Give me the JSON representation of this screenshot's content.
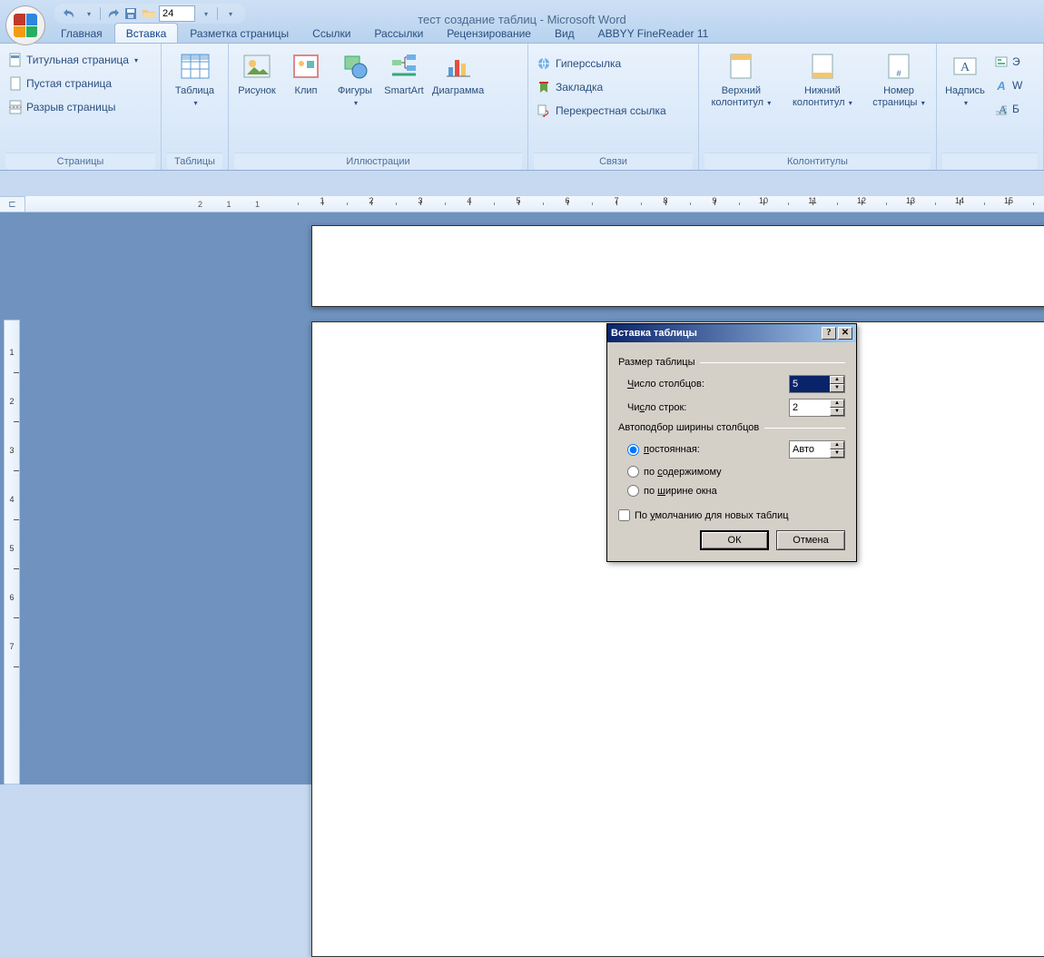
{
  "app_title": "тест создание таблиц - Microsoft Word",
  "qat": {
    "font_size": "24"
  },
  "tabs": {
    "home": "Главная",
    "insert": "Вставка",
    "layout": "Разметка страницы",
    "refs": "Ссылки",
    "mailings": "Рассылки",
    "review": "Рецензирование",
    "view": "Вид",
    "abbyy": "ABBYY FineReader 11"
  },
  "ribbon": {
    "pages": {
      "title_page": "Титульная страница",
      "blank_page": "Пустая страница",
      "page_break": "Разрыв страницы",
      "group": "Страницы"
    },
    "tables": {
      "table": "Таблица",
      "group": "Таблицы"
    },
    "illustrations": {
      "picture": "Рисунок",
      "clip": "Клип",
      "shapes": "Фигуры",
      "smartart": "SmartArt",
      "chart": "Диаграмма",
      "group": "Иллюстрации"
    },
    "links": {
      "hyperlink": "Гиперссылка",
      "bookmark": "Закладка",
      "crossref": "Перекрестная ссылка",
      "group": "Связи"
    },
    "headers": {
      "header": "Верхний колонтитул",
      "footer": "Нижний колонтитул",
      "pagenum": "Номер страницы",
      "group": "Колонтитулы"
    },
    "text": {
      "textbox": "Надпись",
      "partial1": "Э",
      "partial2": "W",
      "partial3": "Б"
    }
  },
  "ruler_h": [
    "1",
    "2",
    "3",
    "4",
    "5",
    "6",
    "7",
    "8",
    "9",
    "10",
    "11",
    "12",
    "13",
    "14",
    "15",
    "16"
  ],
  "ruler_h_neg": [
    "2",
    "1",
    "1"
  ],
  "ruler_v": [
    "1",
    "2",
    "3",
    "4",
    "5",
    "6",
    "7"
  ],
  "dialog": {
    "title": "Вставка таблицы",
    "section1": "Размер таблицы",
    "cols_label": "Число столбцов:",
    "cols_value": "5",
    "rows_label": "Число строк:",
    "rows_value": "2",
    "section2": "Автоподбор ширины столбцов",
    "fixed": "постоянная:",
    "fixed_value": "Авто",
    "bycontent": "по содержимому",
    "bywindow": "по ширине окна",
    "default_check": "По умолчанию для новых таблиц",
    "ok": "ОК",
    "cancel": "Отмена",
    "cols_access": "Ч",
    "rows_access": "с",
    "fixed_access": "п",
    "content_access": "с",
    "window_access": "ш",
    "default_access": "у"
  }
}
